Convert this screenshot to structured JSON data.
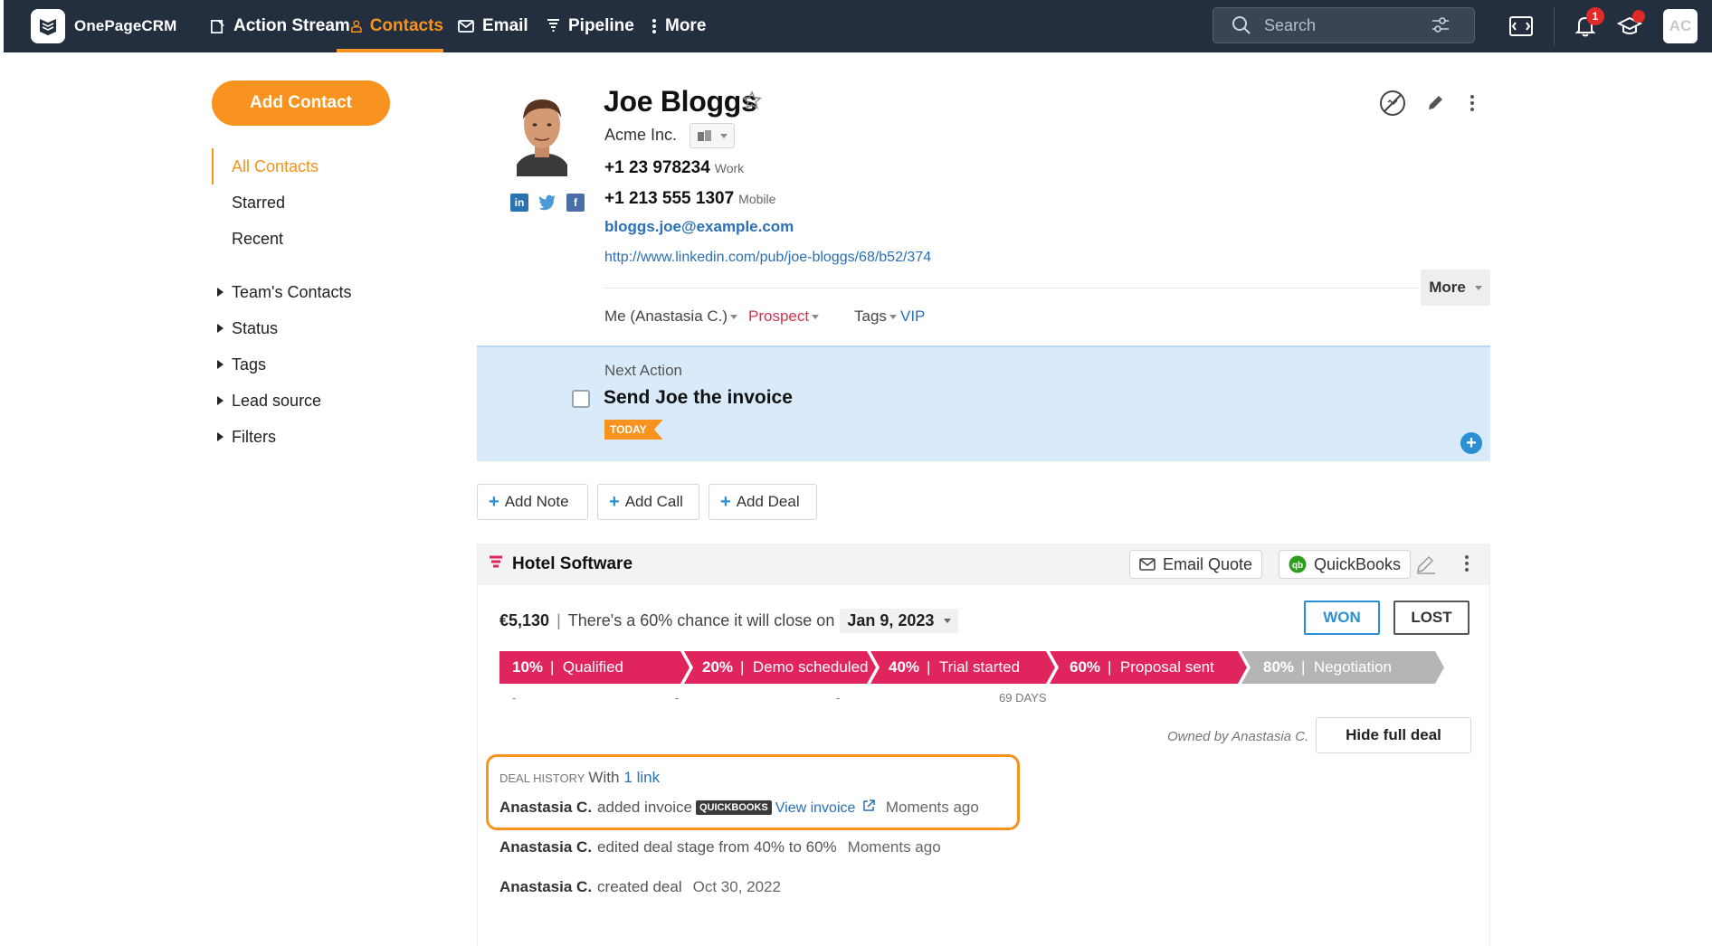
{
  "nav": {
    "brand": "OnePageCRM",
    "items": [
      {
        "label": "Action Stream",
        "icon": "action-stream-icon"
      },
      {
        "label": "Contacts",
        "icon": "contacts-icon",
        "active": true
      },
      {
        "label": "Email",
        "icon": "email-icon"
      },
      {
        "label": "Pipeline",
        "icon": "pipeline-icon"
      },
      {
        "label": "More",
        "icon": "more-vertical-icon"
      }
    ],
    "search_placeholder": "Search",
    "notification_count": "1",
    "avatar_initials": "AC"
  },
  "sidebar": {
    "add_contact": "Add Contact",
    "items": [
      {
        "label": "All Contacts",
        "active": true
      },
      {
        "label": "Starred"
      },
      {
        "label": "Recent"
      }
    ],
    "tree": [
      "Team's Contacts",
      "Status",
      "Tags",
      "Lead source",
      "Filters"
    ]
  },
  "contact": {
    "name": "Joe Bloggs",
    "company": "Acme Inc.",
    "phones": [
      {
        "number": "+1 23 978234",
        "type": "Work"
      },
      {
        "number": "+1 213 555 1307",
        "type": "Mobile"
      }
    ],
    "email": "bloggs.joe@example.com",
    "website": "http://www.linkedin.com/pub/joe-bloggs/68/b52/374",
    "more_label": "More",
    "owner": "Me (Anastasia C.)",
    "status": "Prospect",
    "tags_label": "Tags",
    "tag": "VIP"
  },
  "next_action": {
    "label": "Next Action",
    "title": "Send Joe the invoice",
    "due": "TODAY"
  },
  "actions": {
    "add_note": "Add Note",
    "add_call": "Add Call",
    "add_deal": "Add Deal"
  },
  "deal": {
    "title": "Hotel Software",
    "email_quote": "Email Quote",
    "quickbooks": "QuickBooks",
    "amount": "€5,130",
    "chance_text": "There's a 60% chance it will close on",
    "close_date": "Jan 9, 2023",
    "won": "WON",
    "lost": "LOST",
    "stages": [
      {
        "pct": "10%",
        "name": "Qualified",
        "sub": "-",
        "active": true
      },
      {
        "pct": "20%",
        "name": "Demo scheduled",
        "sub": "-",
        "active": true
      },
      {
        "pct": "40%",
        "name": "Trial started",
        "sub": "-",
        "active": true
      },
      {
        "pct": "60%",
        "name": "Proposal sent",
        "sub": "69 DAYS",
        "active": true
      },
      {
        "pct": "80%",
        "name": "Negotiation",
        "sub": "",
        "active": false
      }
    ],
    "owned_by": "Owned by Anastasia C.",
    "hide_full_deal": "Hide full deal",
    "history_label": "DEAL HISTORY",
    "history_with": "With",
    "history_link": "1 link",
    "history": [
      {
        "user": "Anastasia C.",
        "text": "added invoice",
        "badge": "QUICKBOOKS",
        "link": "View invoice",
        "ago": "Moments ago"
      },
      {
        "user": "Anastasia C.",
        "text": "edited deal stage from 40% to 60%",
        "ago": "Moments ago"
      },
      {
        "user": "Anastasia C.",
        "text": "created deal",
        "ago": "Oct 30, 2022"
      }
    ]
  },
  "colors": {
    "nav_bg": "#232f3e",
    "accent": "#f7931e",
    "stage_active": "#e0245e",
    "stage_inactive": "#b5b5b5",
    "link": "#2b6fb5",
    "next_action_bg": "#d9ebfb"
  }
}
